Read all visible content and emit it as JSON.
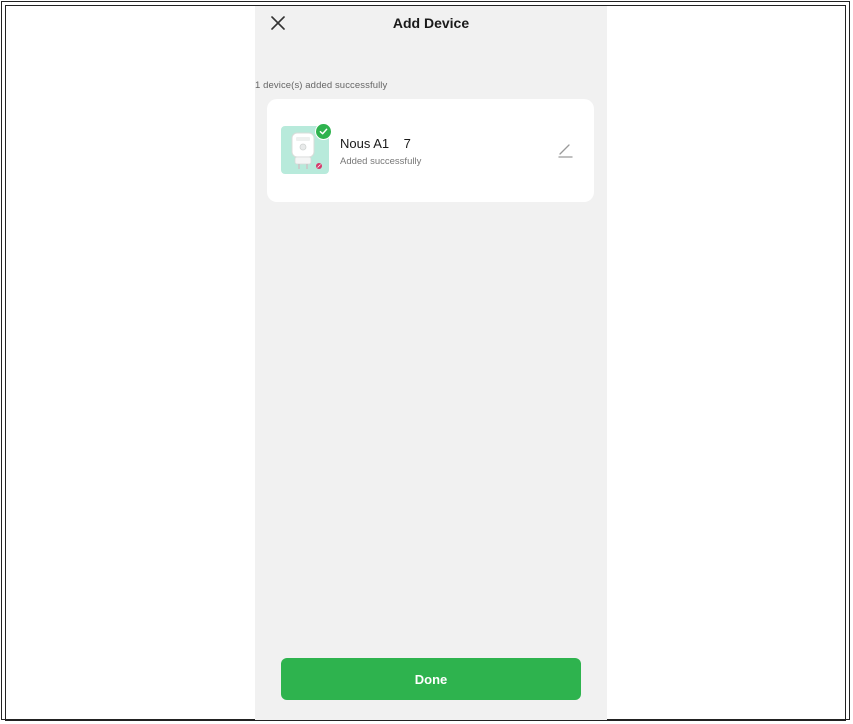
{
  "header": {
    "title": "Add Device",
    "close_icon": "close-icon"
  },
  "status": {
    "summary": "1 device(s) added successfully"
  },
  "devices": [
    {
      "name": "Nous A1    7",
      "status": "Added successfully",
      "thumb_icon": "smart-plug-icon",
      "badge_icon": "check-icon",
      "edit_icon": "pencil-icon"
    }
  ],
  "actions": {
    "done_label": "Done"
  },
  "colors": {
    "accent": "#2eb34e",
    "background": "#f1f1f1",
    "card": "#ffffff",
    "thumb_bg": "#b8eadb"
  }
}
